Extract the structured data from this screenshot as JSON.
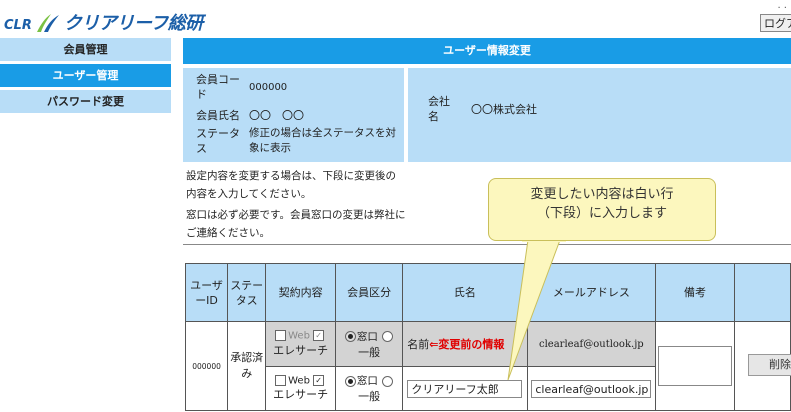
{
  "header": {
    "logo_prefix": "CLR",
    "logo_name": "クリアリーフ総研",
    "corner_dots": ". .",
    "logout_label": "ログア"
  },
  "sidebar": {
    "items": [
      {
        "label": "会員管理",
        "active": false
      },
      {
        "label": "ユーザー管理",
        "active": true
      },
      {
        "label": "パスワード変更",
        "active": false
      }
    ]
  },
  "page": {
    "title": "ユーザー情報変更"
  },
  "info": {
    "member_code_label": "会員コード",
    "member_code_value": "000000",
    "member_name_label": "会員氏名",
    "member_name_value": "〇〇　〇〇",
    "status_label": "ステータス",
    "status_value": "修正の場合は全ステータスを対象に表示",
    "company_label": "会社名",
    "company_value": "〇〇株式会社"
  },
  "notes": {
    "note1": "設定内容を変更する場合は、下段に変更後の内容を入力してください。",
    "note2": "窓口は必ず必要です。会員窓口の変更は弊社にご連絡ください。"
  },
  "callout": {
    "line1": "変更したい内容は白い行",
    "line2": "（下段）に入力します"
  },
  "table": {
    "headers": [
      "ユーザーID",
      "ステータス",
      "契約内容",
      "会員区分",
      "氏名",
      "メールアドレス",
      "備考"
    ],
    "row": {
      "user_id": "000000",
      "status": "承認済み",
      "before": {
        "contract_web": "Web",
        "contract_elesearch": "エレサーチ",
        "member_type_contact": "窓口",
        "member_type_general": "一般",
        "name_prefix": "名前",
        "name_annotation": "⇐変更前の情報",
        "email": "clearleaf@outlook.jp"
      },
      "after": {
        "contract_web": "Web",
        "contract_elesearch": "エレサーチ",
        "member_type_contact": "窓口",
        "member_type_general": "一般",
        "name_value": "クリアリーフ太郎",
        "email_value": "clearleaf@outlook.jp"
      },
      "delete_label": "削除"
    }
  },
  "colors": {
    "accent": "#199ce6",
    "light_blue": "#b8ddf7",
    "callout_bg": "#fcf7be",
    "annotation_red": "#e00000"
  }
}
